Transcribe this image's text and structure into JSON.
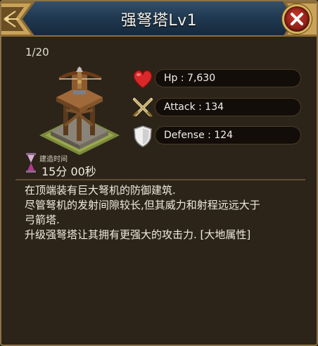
{
  "title": "强弩塔Lv1",
  "level_count": "1/20",
  "stats": [
    {
      "icon": "heart-icon",
      "text": "Hp : 7,630"
    },
    {
      "icon": "crossed-swords-icon",
      "text": "Attack : 134"
    },
    {
      "icon": "shield-icon",
      "text": "Defense : 124"
    }
  ],
  "build": {
    "label": "建造时间",
    "time": "15分 00秒"
  },
  "description": [
    "在顶端装有巨大弩机的防御建筑.",
    "尽管弩机的发射间隙较长,但其威力和射程远远大于",
    "弓箭塔.",
    "升级强弩塔让其拥有更强大的攻击力. [大地属性]"
  ],
  "colors": {
    "header_blue": "#1f3850",
    "gold_border": "#8c7346",
    "close_red": "#b02a1e",
    "heart_red": "#d8282a",
    "hourglass_purple": "#b03a8f"
  }
}
